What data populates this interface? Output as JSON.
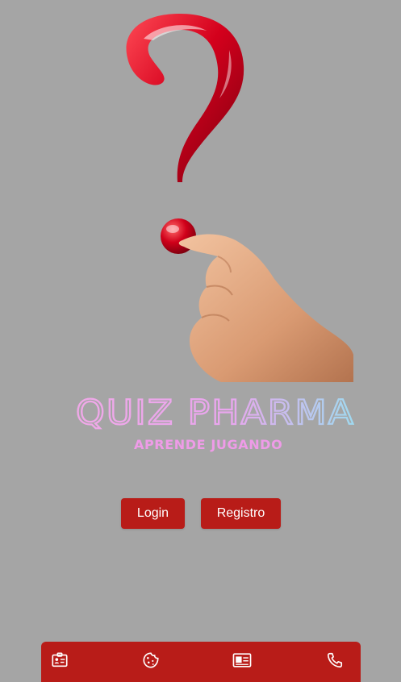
{
  "brand": {
    "title": "QUIZ PHARMA",
    "subtitle": "APRENDE JUGANDO"
  },
  "buttons": {
    "login_label": "Login",
    "register_label": "Registro"
  },
  "bottom_nav": {
    "items": [
      {
        "icon": "id-card-icon"
      },
      {
        "icon": "cookie-icon"
      },
      {
        "icon": "contact-card-icon"
      },
      {
        "icon": "phone-icon"
      }
    ]
  },
  "colors": {
    "background": "#a5a5a5",
    "accent": "#b81c18",
    "brand_pink": "#ef9be8",
    "brand_blue": "#9fdaf0"
  }
}
